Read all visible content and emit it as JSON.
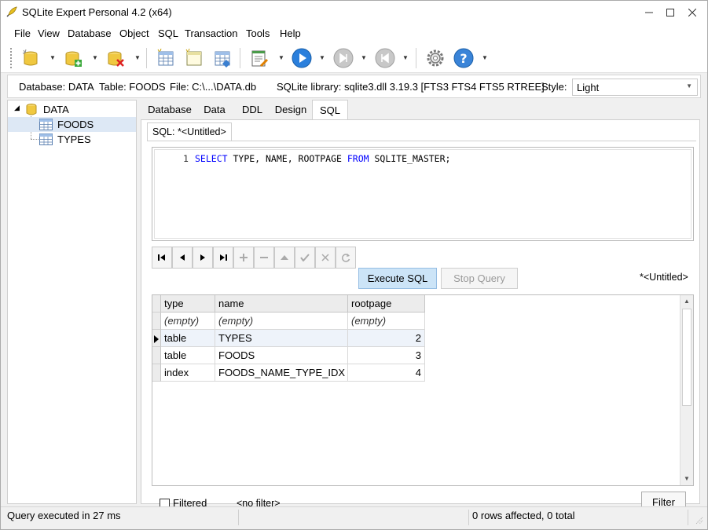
{
  "window": {
    "title": "SQLite Expert Personal 4.2 (x64)"
  },
  "menu": [
    "File",
    "View",
    "Database",
    "Object",
    "SQL",
    "Transaction",
    "Tools",
    "Help"
  ],
  "infobar": {
    "database": "Database: DATA",
    "table": "Table: FOODS",
    "file": "File: C:\\...\\DATA.db",
    "library": "SQLite library: sqlite3.dll 3.19.3 [FTS3 FTS4 FTS5 RTREE]",
    "style_label": "Style:",
    "style_value": "Light"
  },
  "tree": {
    "root": "DATA",
    "items": [
      "FOODS",
      "TYPES"
    ],
    "selected": "FOODS"
  },
  "tabs": [
    "Database",
    "Data",
    "DDL",
    "Design",
    "SQL"
  ],
  "active_tab": "SQL",
  "sql_tab": {
    "label": "SQL: *<Untitled>"
  },
  "editor": {
    "line_number": "1",
    "kw_select": "SELECT",
    "cols": " TYPE, NAME, ROOTPAGE ",
    "kw_from": "FROM",
    "table": " SQLITE_MASTER;"
  },
  "buttons": {
    "execute": "Execute SQL",
    "stop": "Stop Query",
    "filter": "Filter"
  },
  "query_name": "*<Untitled>",
  "grid": {
    "columns": [
      "type",
      "name",
      "rootpage"
    ],
    "filter_placeholder": "(empty)",
    "rows": [
      [
        "table",
        "TYPES",
        "2"
      ],
      [
        "table",
        "FOODS",
        "3"
      ],
      [
        "index",
        "FOODS_NAME_TYPE_IDX",
        "4"
      ]
    ]
  },
  "filter_bar": {
    "checkbox_label": "Filtered",
    "status": "<no filter>"
  },
  "status": {
    "left": "Query executed in 27 ms",
    "right": "0 rows affected, 0 total"
  }
}
